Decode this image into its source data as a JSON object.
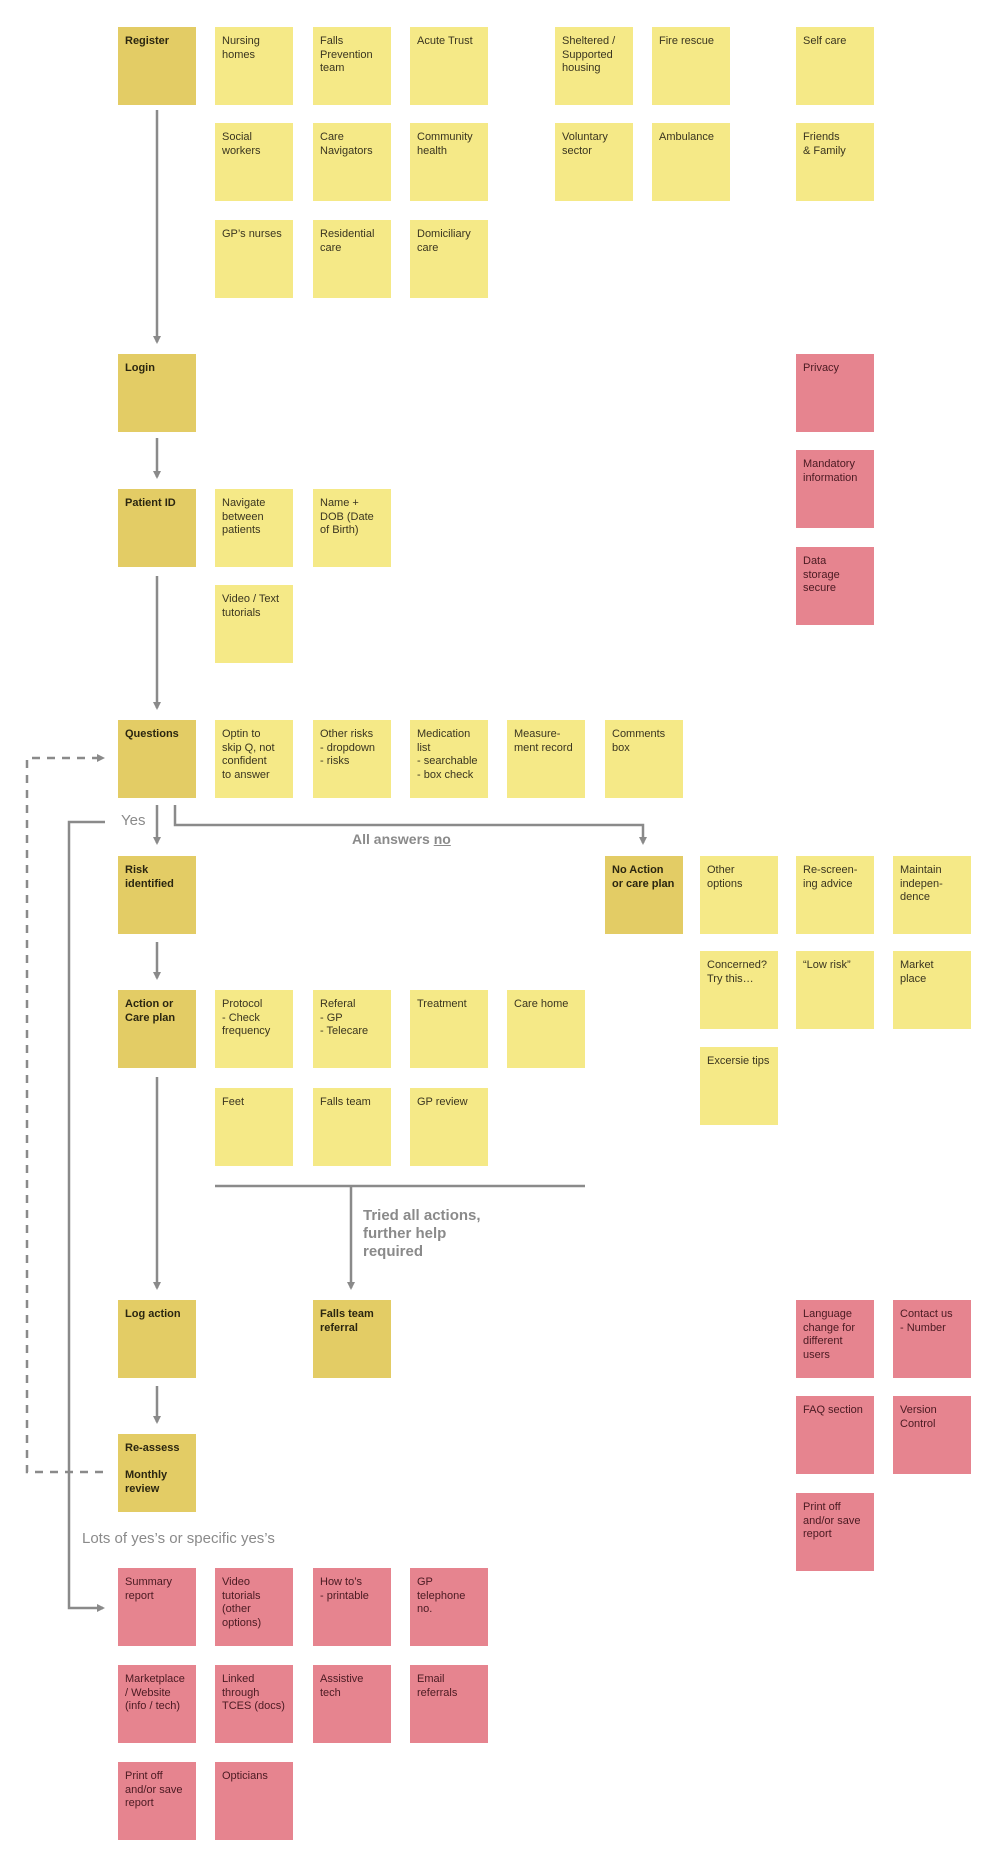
{
  "colors": {
    "step": "#e3cc65",
    "idea": "#f5e987",
    "requirement": "#e6848f",
    "connector": "#8a8a8a"
  },
  "steps": {
    "register": "Register",
    "login": "Login",
    "patient_id": "Patient ID",
    "questions": "Questions",
    "risk_identified": "Risk\nidentified",
    "action_care_plan": "Action or\nCare plan",
    "log_action": "Log action",
    "reassess": "Re-assess\n\nMonthly\nreview",
    "no_action": "No Action\nor care plan",
    "falls_team_referral": "Falls team\nreferral"
  },
  "register_stakeholders": [
    "Nursing\nhomes",
    "Falls\nPrevention\nteam",
    "Acute Trust",
    "Sheltered /\nSupported\nhousing",
    "Fire rescue",
    "Self care",
    "Social\nworkers",
    "Care\nNavigators",
    "Community\nhealth",
    "Voluntary\nsector",
    "Ambulance",
    "Friends\n& Family",
    "GP’s nurses",
    "Residential\ncare",
    "Domiciliary\ncare"
  ],
  "login_requirements": [
    "Privacy",
    "Mandatory\ninformation",
    "Data\nstorage\nsecure"
  ],
  "patient_id_ideas": [
    "Navigate\nbetween\npatients",
    "Name +\nDOB (Date\nof Birth)",
    "Video / Text\ntutorials"
  ],
  "question_ideas": [
    "Optin to\nskip Q, not\nconfident\nto answer",
    "Other risks\n- dropdown\n- risks",
    "Medication\nlist\n- searchable\n- box check",
    "Measure-\nment record",
    "Comments\nbox"
  ],
  "no_action_ideas": [
    "Other\noptions",
    "Re-screen-\ning advice",
    "Maintain\nindepen-\ndence",
    "Concerned?\nTry this…",
    "“Low risk”",
    "Market\nplace",
    "Excersie tips"
  ],
  "action_ideas": [
    "Protocol\n- Check\n  frequency",
    "Referal\n- GP\n- Telecare",
    "Treatment",
    "Care home",
    "Feet",
    "Falls team",
    "GP review"
  ],
  "general_requirements": [
    "Language\nchange for\ndifferent\nusers",
    "Contact us\n- Number",
    "FAQ section",
    "Version\nControl",
    "Print off\nand/or save\nreport"
  ],
  "output_requirements": [
    "Summary\nreport",
    "Video\ntutorials\n(other\noptions)",
    "How to’s\n- printable",
    "GP\ntelephone\nno.",
    "Marketplace\n/ Website\n(info / tech)",
    "Linked\nthrough\nTCES (docs)",
    "Assistive\ntech",
    "Email\nreferrals",
    "Print off\nand/or save\nreport",
    "Opticians"
  ],
  "labels": {
    "yes": "Yes",
    "all_answers": "All answers ",
    "no": "no",
    "tried_all": "Tried all actions,\nfurther help\nrequired",
    "lots_of_yes": "Lots of yes’s or specific yes’s"
  }
}
